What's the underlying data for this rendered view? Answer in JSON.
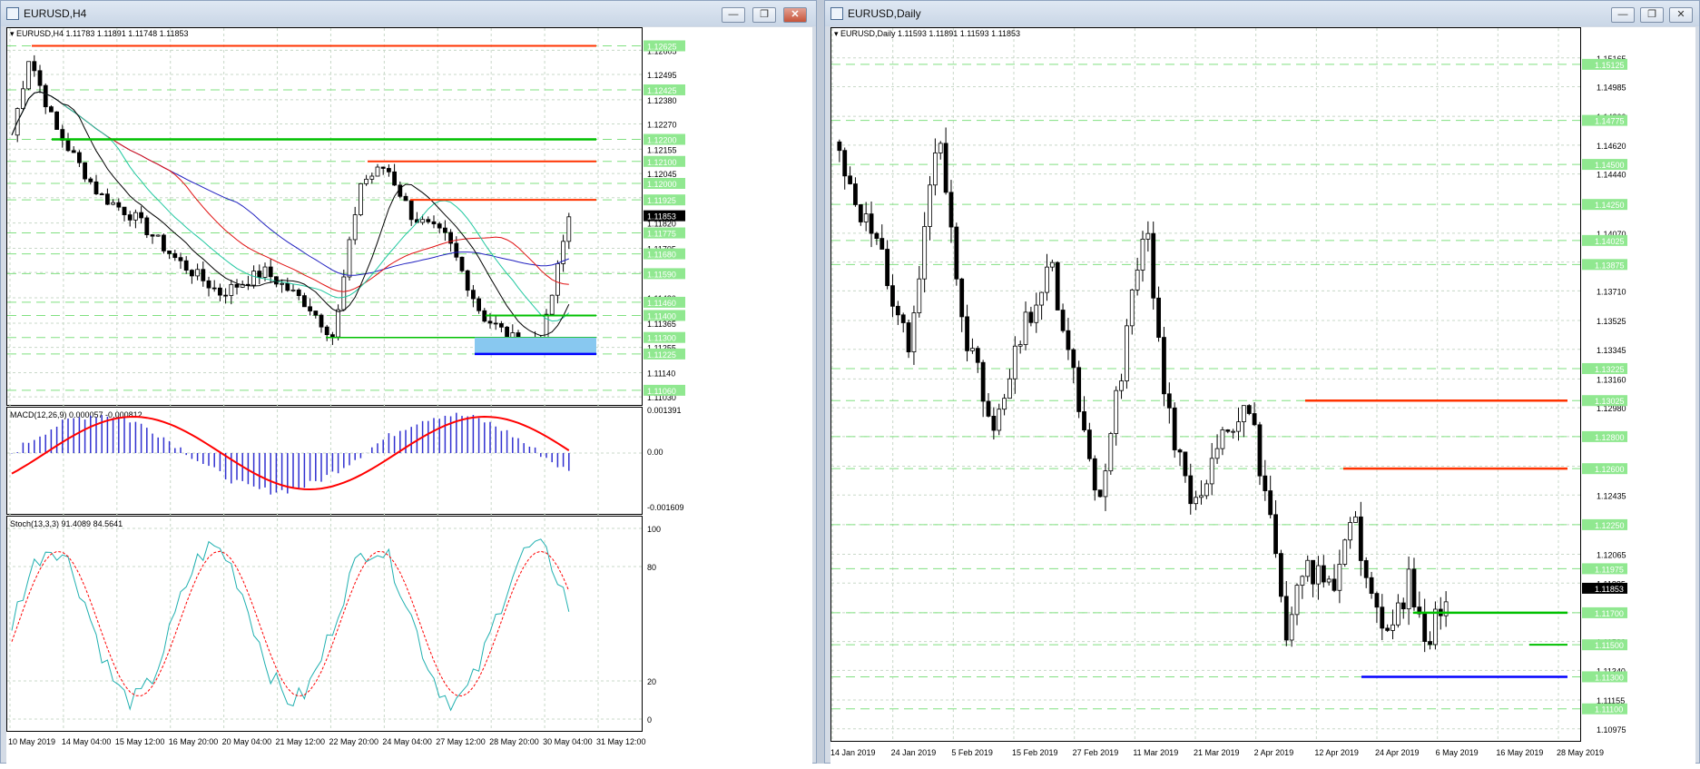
{
  "h4": {
    "window_title": "EURUSD,H4",
    "header_symbol": "EURUSD,H4",
    "header_ohlc": "1.11783 1.11891 1.11748 1.11853",
    "price_ticks": [
      "1.12605",
      "1.12495",
      "1.12380",
      "1.12270",
      "1.12155",
      "1.12045",
      "1.11935",
      "1.11820",
      "1.11705",
      "1.11595",
      "1.11480",
      "1.11365",
      "1.11255",
      "1.11140",
      "1.11030"
    ],
    "level_tags": [
      "1.12625",
      "1.12425",
      "1.12200",
      "1.12100",
      "1.12000",
      "1.11925",
      "1.11775",
      "1.11680",
      "1.11590",
      "1.11460",
      "1.11400",
      "1.11300",
      "1.11225",
      "1.11060"
    ],
    "current_price": "1.11853",
    "macd_label": "MACD(12,26,9) 0.000057 -0.000812",
    "macd_ticks": [
      "0.001391",
      "0.00",
      "-0.001609"
    ],
    "stoch_label": "Stoch(13,3,3) 91.4089 84.5641",
    "stoch_ticks": [
      "100",
      "80",
      "20",
      "0"
    ],
    "time_ticks": [
      "10 May 2019",
      "14 May 04:00",
      "15 May 12:00",
      "16 May 20:00",
      "20 May 04:00",
      "21 May 12:00",
      "22 May 20:00",
      "24 May 04:00",
      "27 May 12:00",
      "28 May 20:00",
      "30 May 04:00",
      "31 May 12:00"
    ]
  },
  "daily": {
    "window_title": "EURUSD,Daily",
    "header_symbol": "EURUSD,Daily",
    "header_ohlc": "1.11593 1.11891 1.11593 1.11853",
    "price_ticks": [
      "1.15165",
      "1.14985",
      "1.14800",
      "1.14620",
      "1.14440",
      "1.14070",
      "1.13890",
      "1.13710",
      "1.13525",
      "1.13345",
      "1.13160",
      "1.12980",
      "1.12800",
      "1.12615",
      "1.12435",
      "1.12250",
      "1.12065",
      "1.11885",
      "1.11700",
      "1.11520",
      "1.11340",
      "1.11155",
      "1.10975"
    ],
    "level_tags": [
      "1.15125",
      "1.14775",
      "1.14500",
      "1.14250",
      "1.14025",
      "1.13875",
      "1.13225",
      "1.13025",
      "1.12800",
      "1.12600",
      "1.12250",
      "1.11975",
      "1.11700",
      "1.11500",
      "1.11300",
      "1.11100"
    ],
    "current_price": "1.11853",
    "time_ticks": [
      "14 Jan 2019",
      "24 Jan 2019",
      "5 Feb 2019",
      "15 Feb 2019",
      "27 Feb 2019",
      "11 Mar 2019",
      "21 Mar 2019",
      "2 Apr 2019",
      "12 Apr 2019",
      "24 Apr 2019",
      "6 May 2019",
      "16 May 2019",
      "28 May 2019"
    ]
  },
  "window_buttons": {
    "minimize": "—",
    "restore": "❐",
    "close": "✕"
  },
  "colors": {
    "resistance": "#ff3300",
    "support": "#00c000",
    "blue_line": "#0000ff",
    "zone": "#88c8f0",
    "ma_red": "#e01010",
    "ma_blue": "#2020c0",
    "ma_black": "#000000",
    "ma_teal": "#20c8a0",
    "grid": "#c8d8c8",
    "level_dash": "#80e080",
    "tag_bg": "#90e890"
  }
}
